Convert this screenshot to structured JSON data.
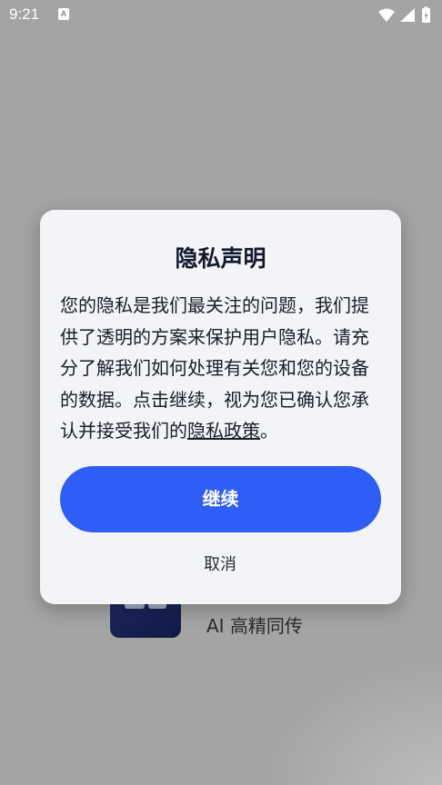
{
  "status_bar": {
    "time": "9:21",
    "notification_letter": "A",
    "icons": [
      "wifi-icon",
      "signal-icon",
      "battery-charging-icon"
    ]
  },
  "background_app": {
    "icon": "app-icon",
    "label": "AI 高精同传"
  },
  "dialog": {
    "title": "隐私声明",
    "body_text": "您的隐私是我们最关注的问题，我们提供了透明的方案来保护用户隐私。请充分了解我们如何处理有关您和您的设备的数据。点击继续，视为您已确认您承认并接受我们的",
    "policy_link": "隐私政策",
    "body_suffix": "。",
    "continue_label": "继续",
    "cancel_label": "取消"
  },
  "colors": {
    "accent": "#2e5ef5",
    "dialog_bg": "#f2f4f8",
    "overlay_bg": "#a4a4a4"
  }
}
